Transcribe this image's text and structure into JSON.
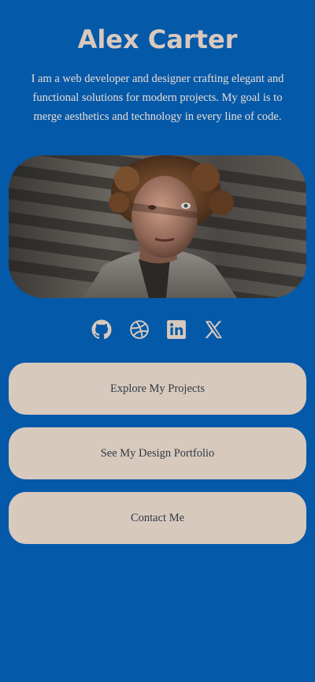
{
  "profile": {
    "name": "Alex Carter",
    "bio": "I am a web developer and designer crafting elegant and functional solutions for modern projects. My goal is to merge aesthetics and technology in every line of code."
  },
  "photo": {
    "icon": "profile-photo"
  },
  "socials": [
    {
      "name": "github",
      "icon": "github-icon"
    },
    {
      "name": "dribbble",
      "icon": "dribbble-icon"
    },
    {
      "name": "linkedin",
      "icon": "linkedin-icon"
    },
    {
      "name": "x",
      "icon": "x-icon"
    }
  ],
  "buttons": {
    "projects": "Explore My Projects",
    "portfolio": "See My Design Portfolio",
    "contact": "Contact Me"
  },
  "colors": {
    "background": "#0559a9",
    "accent": "#d8c9bd",
    "button_text": "#2f3a44"
  }
}
